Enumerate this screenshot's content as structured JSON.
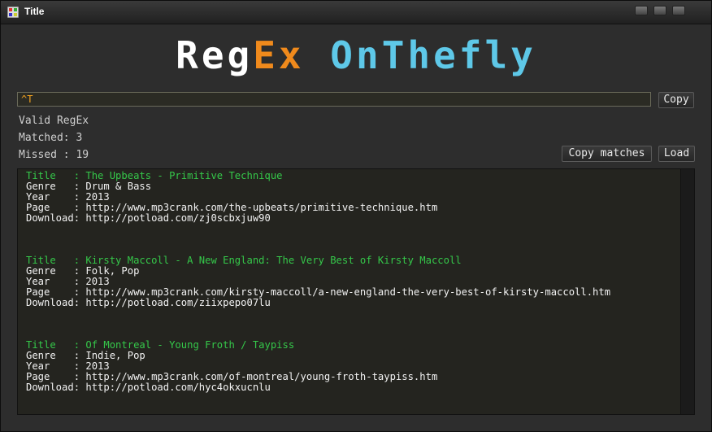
{
  "window": {
    "title": "Title"
  },
  "logo": {
    "part1": "Reg",
    "part2": "Ex",
    "part3": " OnThefly"
  },
  "regex": {
    "value": "^T"
  },
  "buttons": {
    "copy": "Copy",
    "copy_matches": "Copy matches",
    "load": "Load"
  },
  "status": {
    "valid": "Valid RegEx",
    "matched": "Matched: 3",
    "missed": "Missed : 19"
  },
  "entries": [
    {
      "title": "Title   : The Upbeats - Primitive Technique",
      "genre": "Genre   : Drum & Bass",
      "year": "Year    : 2013",
      "page": "Page    : http://www.mp3crank.com/the-upbeats/primitive-technique.htm",
      "download": "Download: http://potload.com/zj0scbxjuw90"
    },
    {
      "title": "Title   : Kirsty Maccoll - A New England: The Very Best of Kirsty Maccoll",
      "genre": "Genre   : Folk, Pop",
      "year": "Year    : 2013",
      "page": "Page    : http://www.mp3crank.com/kirsty-maccoll/a-new-england-the-very-best-of-kirsty-maccoll.htm",
      "download": "Download: http://potload.com/ziixpepo07lu"
    },
    {
      "title": "Title   : Of Montreal - Young Froth / Taypiss",
      "genre": "Genre   : Indie, Pop",
      "year": "Year    : 2013",
      "page": "Page    : http://www.mp3crank.com/of-montreal/young-froth-taypiss.htm",
      "download": "Download: http://potload.com/hyc4okxucnlu"
    }
  ]
}
